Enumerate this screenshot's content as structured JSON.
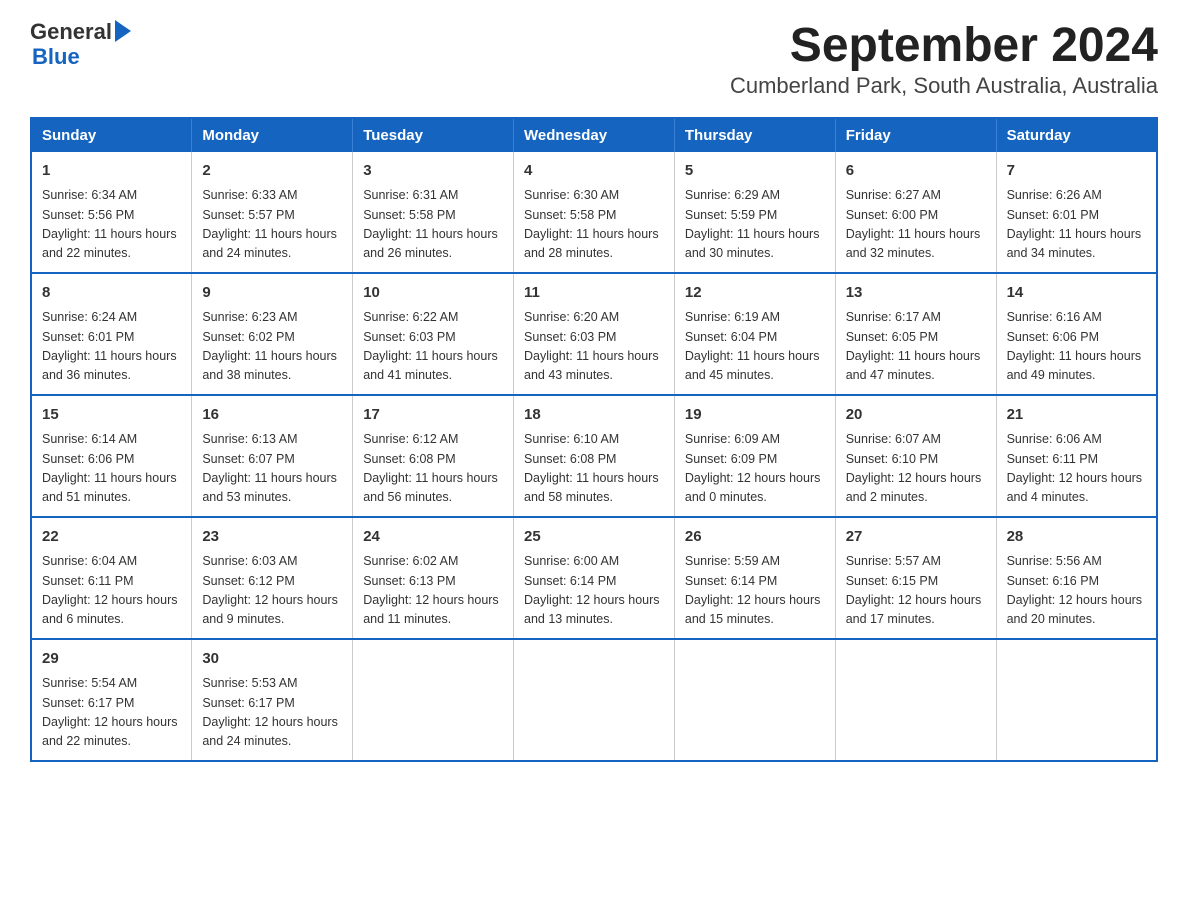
{
  "logo": {
    "text_general": "General",
    "triangle": "▶",
    "text_blue": "Blue"
  },
  "title": "September 2024",
  "subtitle": "Cumberland Park, South Australia, Australia",
  "days_of_week": [
    "Sunday",
    "Monday",
    "Tuesday",
    "Wednesday",
    "Thursday",
    "Friday",
    "Saturday"
  ],
  "weeks": [
    [
      {
        "day": "1",
        "sunrise": "6:34 AM",
        "sunset": "5:56 PM",
        "daylight": "11 hours and 22 minutes."
      },
      {
        "day": "2",
        "sunrise": "6:33 AM",
        "sunset": "5:57 PM",
        "daylight": "11 hours and 24 minutes."
      },
      {
        "day": "3",
        "sunrise": "6:31 AM",
        "sunset": "5:58 PM",
        "daylight": "11 hours and 26 minutes."
      },
      {
        "day": "4",
        "sunrise": "6:30 AM",
        "sunset": "5:58 PM",
        "daylight": "11 hours and 28 minutes."
      },
      {
        "day": "5",
        "sunrise": "6:29 AM",
        "sunset": "5:59 PM",
        "daylight": "11 hours and 30 minutes."
      },
      {
        "day": "6",
        "sunrise": "6:27 AM",
        "sunset": "6:00 PM",
        "daylight": "11 hours and 32 minutes."
      },
      {
        "day": "7",
        "sunrise": "6:26 AM",
        "sunset": "6:01 PM",
        "daylight": "11 hours and 34 minutes."
      }
    ],
    [
      {
        "day": "8",
        "sunrise": "6:24 AM",
        "sunset": "6:01 PM",
        "daylight": "11 hours and 36 minutes."
      },
      {
        "day": "9",
        "sunrise": "6:23 AM",
        "sunset": "6:02 PM",
        "daylight": "11 hours and 38 minutes."
      },
      {
        "day": "10",
        "sunrise": "6:22 AM",
        "sunset": "6:03 PM",
        "daylight": "11 hours and 41 minutes."
      },
      {
        "day": "11",
        "sunrise": "6:20 AM",
        "sunset": "6:03 PM",
        "daylight": "11 hours and 43 minutes."
      },
      {
        "day": "12",
        "sunrise": "6:19 AM",
        "sunset": "6:04 PM",
        "daylight": "11 hours and 45 minutes."
      },
      {
        "day": "13",
        "sunrise": "6:17 AM",
        "sunset": "6:05 PM",
        "daylight": "11 hours and 47 minutes."
      },
      {
        "day": "14",
        "sunrise": "6:16 AM",
        "sunset": "6:06 PM",
        "daylight": "11 hours and 49 minutes."
      }
    ],
    [
      {
        "day": "15",
        "sunrise": "6:14 AM",
        "sunset": "6:06 PM",
        "daylight": "11 hours and 51 minutes."
      },
      {
        "day": "16",
        "sunrise": "6:13 AM",
        "sunset": "6:07 PM",
        "daylight": "11 hours and 53 minutes."
      },
      {
        "day": "17",
        "sunrise": "6:12 AM",
        "sunset": "6:08 PM",
        "daylight": "11 hours and 56 minutes."
      },
      {
        "day": "18",
        "sunrise": "6:10 AM",
        "sunset": "6:08 PM",
        "daylight": "11 hours and 58 minutes."
      },
      {
        "day": "19",
        "sunrise": "6:09 AM",
        "sunset": "6:09 PM",
        "daylight": "12 hours and 0 minutes."
      },
      {
        "day": "20",
        "sunrise": "6:07 AM",
        "sunset": "6:10 PM",
        "daylight": "12 hours and 2 minutes."
      },
      {
        "day": "21",
        "sunrise": "6:06 AM",
        "sunset": "6:11 PM",
        "daylight": "12 hours and 4 minutes."
      }
    ],
    [
      {
        "day": "22",
        "sunrise": "6:04 AM",
        "sunset": "6:11 PM",
        "daylight": "12 hours and 6 minutes."
      },
      {
        "day": "23",
        "sunrise": "6:03 AM",
        "sunset": "6:12 PM",
        "daylight": "12 hours and 9 minutes."
      },
      {
        "day": "24",
        "sunrise": "6:02 AM",
        "sunset": "6:13 PM",
        "daylight": "12 hours and 11 minutes."
      },
      {
        "day": "25",
        "sunrise": "6:00 AM",
        "sunset": "6:14 PM",
        "daylight": "12 hours and 13 minutes."
      },
      {
        "day": "26",
        "sunrise": "5:59 AM",
        "sunset": "6:14 PM",
        "daylight": "12 hours and 15 minutes."
      },
      {
        "day": "27",
        "sunrise": "5:57 AM",
        "sunset": "6:15 PM",
        "daylight": "12 hours and 17 minutes."
      },
      {
        "day": "28",
        "sunrise": "5:56 AM",
        "sunset": "6:16 PM",
        "daylight": "12 hours and 20 minutes."
      }
    ],
    [
      {
        "day": "29",
        "sunrise": "5:54 AM",
        "sunset": "6:17 PM",
        "daylight": "12 hours and 22 minutes."
      },
      {
        "day": "30",
        "sunrise": "5:53 AM",
        "sunset": "6:17 PM",
        "daylight": "12 hours and 24 minutes."
      },
      null,
      null,
      null,
      null,
      null
    ]
  ],
  "labels": {
    "sunrise": "Sunrise: ",
    "sunset": "Sunset: ",
    "daylight": "Daylight: "
  }
}
